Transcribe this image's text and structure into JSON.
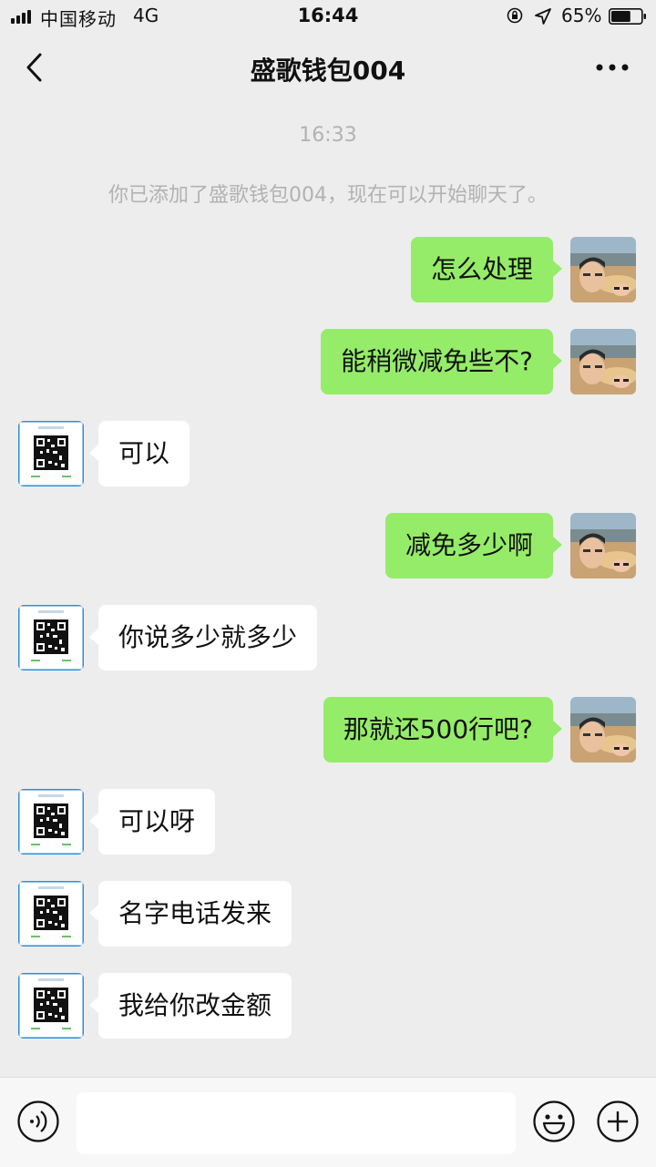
{
  "status_bar": {
    "carrier": "中国移动",
    "network": "4G",
    "time": "16:44",
    "battery": "65%",
    "battery_level": 0.65
  },
  "header": {
    "title": "盛歌钱包004",
    "back_icon": "chevron-left-icon",
    "more_icon": "more-dots-icon"
  },
  "chat": {
    "timestamp": "16:33",
    "system_message": "你已添加了盛歌钱包004，现在可以开始聊天了。",
    "messages": [
      {
        "sender": "me",
        "text": "怎么处理"
      },
      {
        "sender": "me",
        "text": "能稍微减免些不?"
      },
      {
        "sender": "them",
        "text": "可以"
      },
      {
        "sender": "me",
        "text": "减免多少啊"
      },
      {
        "sender": "them",
        "text": "你说多少就多少"
      },
      {
        "sender": "me",
        "text": "那就还500行吧?"
      },
      {
        "sender": "them",
        "text": "可以呀"
      },
      {
        "sender": "them",
        "text": "名字电话发来"
      },
      {
        "sender": "them",
        "text": "我给你改金额"
      }
    ]
  },
  "input_bar": {
    "text_value": "",
    "icons": [
      "voice-icon",
      "emoji-icon",
      "plus-icon"
    ]
  },
  "colors": {
    "background": "#ededed",
    "my_bubble": "#95ec69",
    "their_bubble": "#ffffff",
    "system_text": "#b2b2b2"
  }
}
